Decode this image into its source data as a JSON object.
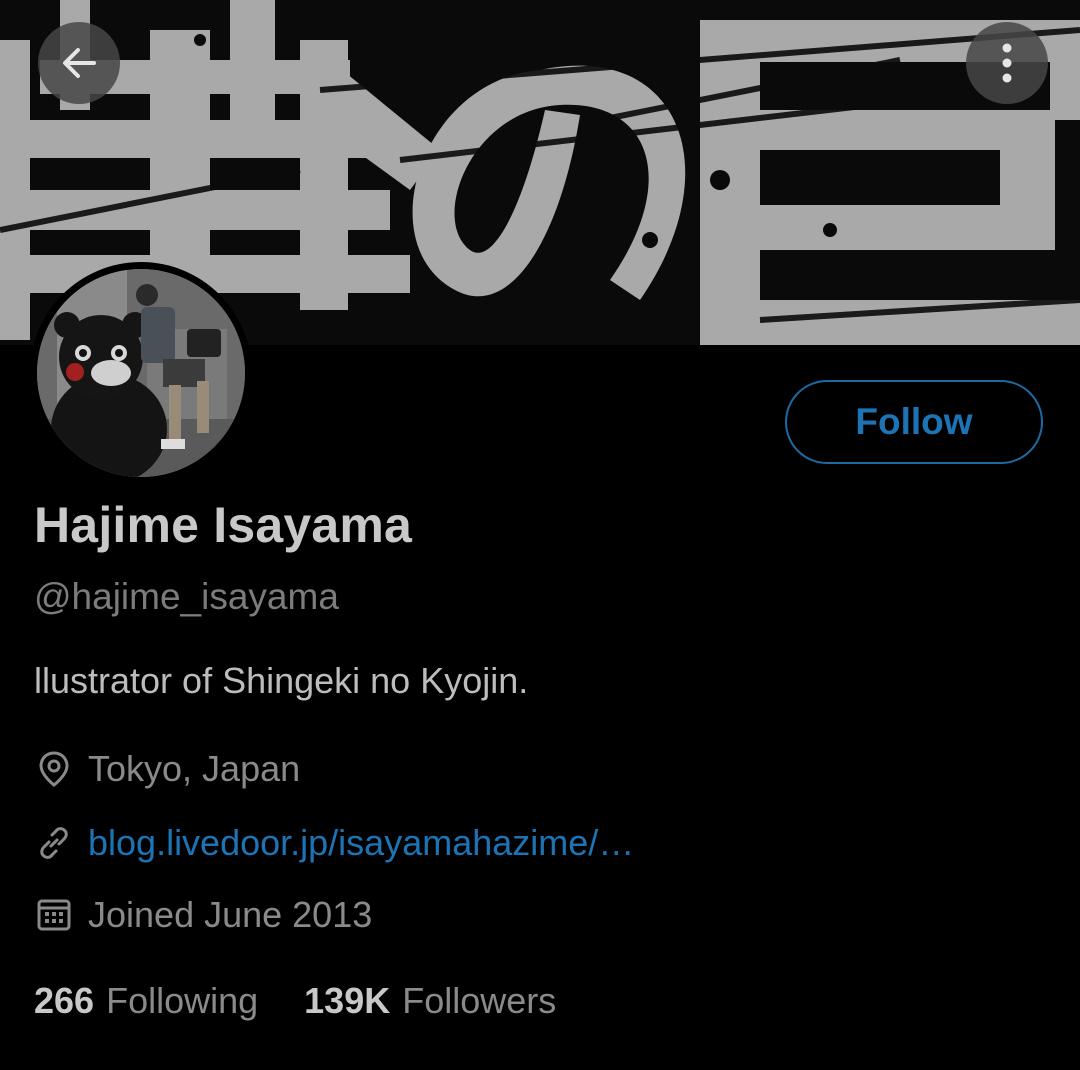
{
  "profile": {
    "name": "Hajime Isayama",
    "handle": "@hajime_isayama",
    "bio": "llustrator of Shingeki no Kyojin.",
    "location": "Tokyo, Japan",
    "website": "blog.livedoor.jp/isayamahazime/…",
    "joined": "Joined June 2013"
  },
  "stats": {
    "following_count": "266",
    "following_label": "Following",
    "followers_count": "139K",
    "followers_label": "Followers"
  },
  "actions": {
    "follow_label": "Follow"
  },
  "icons": {
    "back": "arrow-left-icon",
    "more": "more-vertical-icon",
    "location": "location-pin-icon",
    "link": "link-icon",
    "calendar": "calendar-icon"
  },
  "colors": {
    "background": "#000000",
    "accent": "#1d74b5"
  }
}
